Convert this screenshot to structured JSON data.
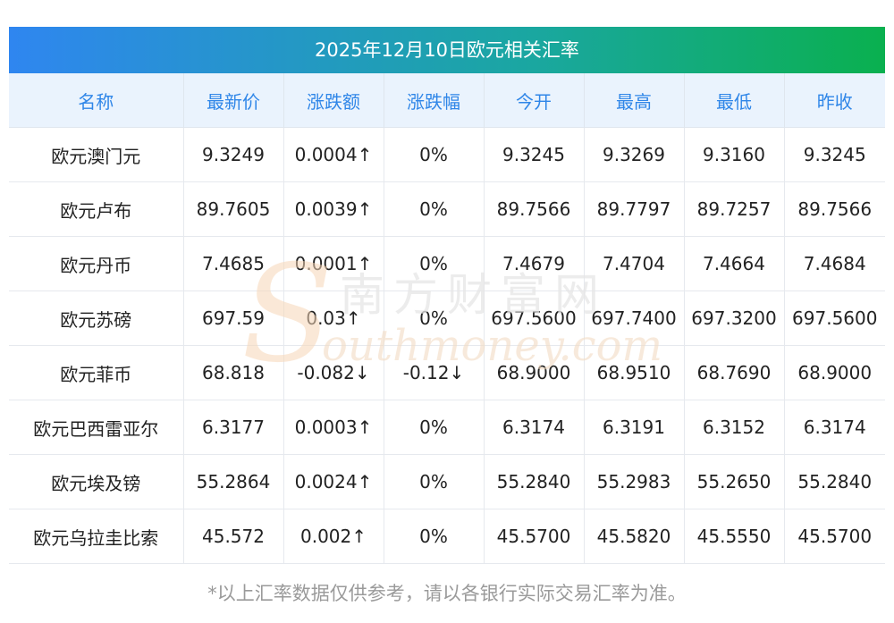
{
  "title": "2025年12月10日欧元相关汇率",
  "headers": [
    "名称",
    "最新价",
    "涨跌额",
    "涨跌幅",
    "今开",
    "最高",
    "最低",
    "昨收"
  ],
  "rows": [
    {
      "name": "欧元澳门元",
      "latest": "9.3249",
      "change": "0.0004↑",
      "pct": "0%",
      "open": "9.3245",
      "high": "9.3269",
      "low": "9.3160",
      "prev": "9.3245",
      "dir": "up"
    },
    {
      "name": "欧元卢布",
      "latest": "89.7605",
      "change": "0.0039↑",
      "pct": "0%",
      "open": "89.7566",
      "high": "89.7797",
      "low": "89.7257",
      "prev": "89.7566",
      "dir": "up"
    },
    {
      "name": "欧元丹币",
      "latest": "7.4685",
      "change": "0.0001↑",
      "pct": "0%",
      "open": "7.4679",
      "high": "7.4704",
      "low": "7.4664",
      "prev": "7.4684",
      "dir": "up"
    },
    {
      "name": "欧元苏磅",
      "latest": "697.59",
      "change": "0.03↑",
      "pct": "0%",
      "open": "697.5600",
      "high": "697.7400",
      "low": "697.3200",
      "prev": "697.5600",
      "dir": "up"
    },
    {
      "name": "欧元菲币",
      "latest": "68.818",
      "change": "-0.082↓",
      "pct": "-0.12↓",
      "open": "68.9000",
      "high": "68.9510",
      "low": "68.7690",
      "prev": "68.9000",
      "dir": "down"
    },
    {
      "name": "欧元巴西雷亚尔",
      "latest": "6.3177",
      "change": "0.0003↑",
      "pct": "0%",
      "open": "6.3174",
      "high": "6.3191",
      "low": "6.3152",
      "prev": "6.3174",
      "dir": "up"
    },
    {
      "name": "欧元埃及镑",
      "latest": "55.2864",
      "change": "0.0024↑",
      "pct": "0%",
      "open": "55.2840",
      "high": "55.2983",
      "low": "55.2650",
      "prev": "55.2840",
      "dir": "up"
    },
    {
      "name": "欧元乌拉圭比索",
      "latest": "45.572",
      "change": "0.002↑",
      "pct": "0%",
      "open": "45.5700",
      "high": "45.5820",
      "low": "45.5550",
      "prev": "45.5700",
      "dir": "up"
    }
  ],
  "footnote": "*以上汇率数据仅供参考，请以各银行实际交易汇率为准。",
  "watermark": {
    "cn": "南方财富网",
    "en": "outhmoney.com",
    "s": "S"
  },
  "colors": {
    "up": "#e8202a",
    "down": "#1a8a1a",
    "header_text": "#2f86e8",
    "title_start": "#2f86f0",
    "title_end": "#0ab04f"
  }
}
